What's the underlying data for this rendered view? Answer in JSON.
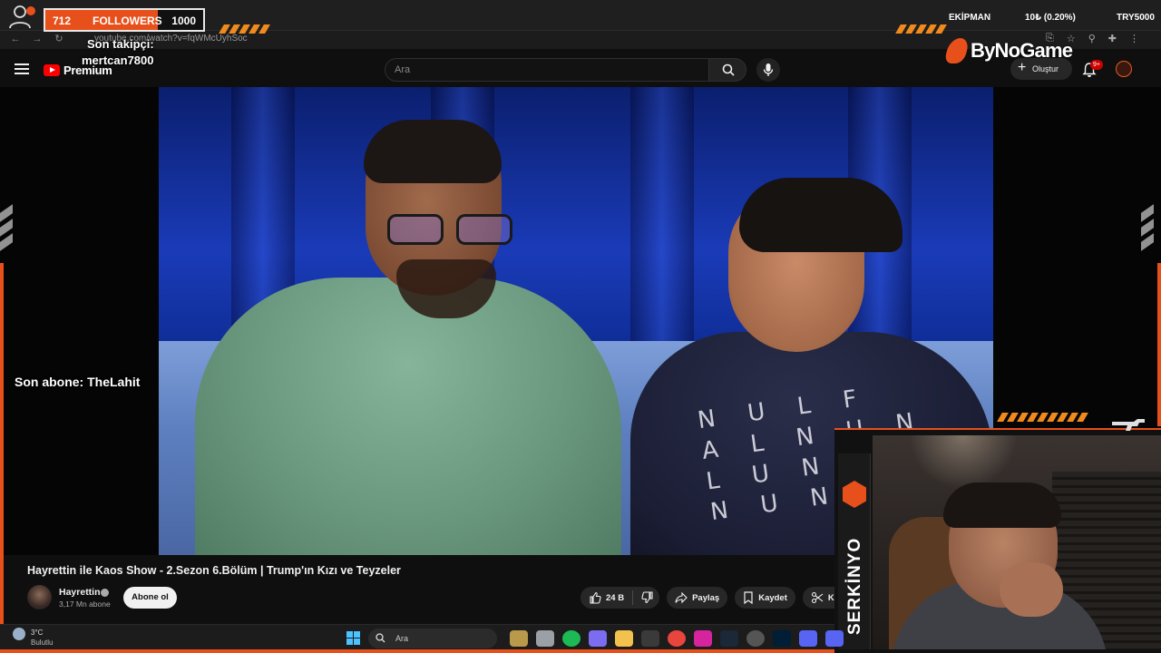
{
  "overlay": {
    "followers_current": "712",
    "followers_label": "FOLLOWERS",
    "followers_goal": "1000",
    "followers_progress": 0.712,
    "son_takipci_label": "Son takipçi:",
    "son_takipci_name": "mertcan7800",
    "son_abone": "Son abone: TheLahit",
    "top_right_1": "EKİPMAN",
    "top_right_2": "10₺ (0.20%)",
    "top_right_3": "TRY5000",
    "brand": "ByNoGame",
    "streamer_name": "SERKİNYO",
    "accent": "#e8501b"
  },
  "browser": {
    "url": "youtube.com/watch?v=fqWMcUyhSoc"
  },
  "youtube": {
    "logo_text": "Premium",
    "search_placeholder": "Ara",
    "create_label": "Oluştur",
    "notification_count": "9+"
  },
  "video": {
    "title": "Hayrettin ile Kaos Show - 2.Sezon 6.Bölüm | Trump'ın Kızı ve Teyzeler",
    "channel_name": "Hayrettin",
    "subscribers": "3,17 Mn abone",
    "subscribe_label": "Abone ol",
    "likes": "24 B",
    "share_label": "Paylaş",
    "save_label": "Kaydet",
    "clip_label": "Klip",
    "shirt_text": "NULF\nALNUNU\nLUNFA\nNUNFAL"
  },
  "taskbar": {
    "temperature": "3°C",
    "condition": "Bulutlu",
    "search_placeholder": "Ara",
    "apps": [
      "bushes-app-icon",
      "file-icon",
      "spotify-icon",
      "copilot-icon",
      "folder-icon",
      "store-icon",
      "chrome-icon",
      "instagram-icon",
      "steam-icon",
      "obs-icon",
      "photoshop-icon",
      "discord-icon-2",
      "discord-icon"
    ]
  }
}
